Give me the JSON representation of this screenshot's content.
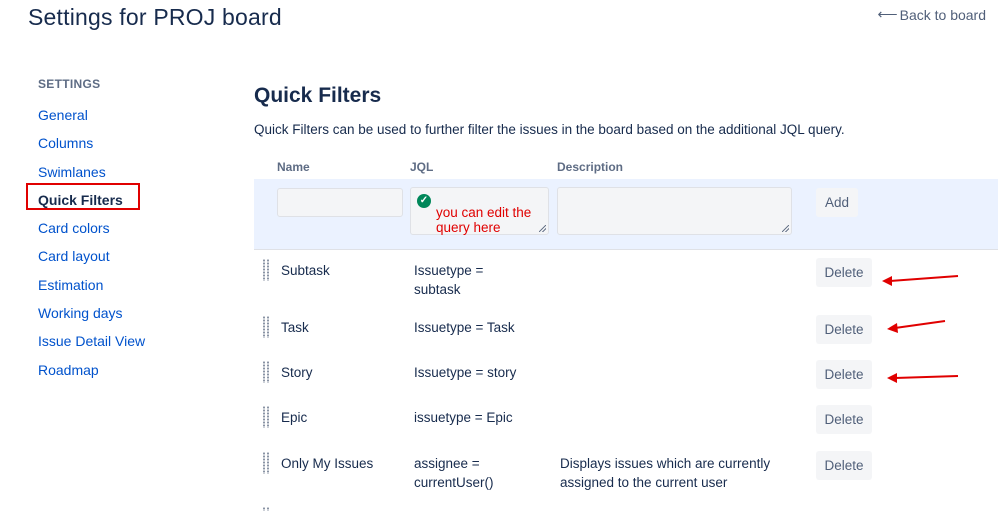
{
  "header": {
    "title": "Settings for PROJ board",
    "back_label": "Back to board",
    "back_icon": "arrow-left-icon"
  },
  "sidebar": {
    "heading": "SETTINGS",
    "items": [
      {
        "label": "General"
      },
      {
        "label": "Columns"
      },
      {
        "label": "Swimlanes"
      },
      {
        "label": "Quick Filters",
        "active": true
      },
      {
        "label": "Card colors"
      },
      {
        "label": "Card layout"
      },
      {
        "label": "Estimation"
      },
      {
        "label": "Working days"
      },
      {
        "label": "Issue Detail View"
      },
      {
        "label": "Roadmap"
      }
    ]
  },
  "main": {
    "title": "Quick Filters",
    "description": "Quick Filters can be used to further filter the issues in the board based on the additional JQL query.",
    "columns": {
      "name": "Name",
      "jql": "JQL",
      "description": "Description"
    },
    "add_form": {
      "name_value": "",
      "jql_annotation": "you can edit the query here",
      "description_value": "",
      "add_label": "Add"
    },
    "filters": [
      {
        "name": "Subtask",
        "jql_line1": "Issuetype =",
        "jql_line2": "subtask",
        "desc_line1": "",
        "desc_line2": "",
        "delete_label": "Delete",
        "annotated": true
      },
      {
        "name": "Task",
        "jql_line1": "Issuetype = Task",
        "jql_line2": "",
        "desc_line1": "",
        "desc_line2": "",
        "delete_label": "Delete",
        "annotated": true
      },
      {
        "name": "Story",
        "jql_line1": "Issuetype = story",
        "jql_line2": "",
        "desc_line1": "",
        "desc_line2": "",
        "delete_label": "Delete",
        "annotated": true
      },
      {
        "name": "Epic",
        "jql_line1": "issuetype = Epic",
        "jql_line2": "",
        "desc_line1": "",
        "desc_line2": "",
        "delete_label": "Delete",
        "annotated": false
      },
      {
        "name": "Only My Issues",
        "jql_line1": "assignee =",
        "jql_line2": "currentUser()",
        "desc_line1": "Displays issues which are currently",
        "desc_line2": "assigned to the current user",
        "delete_label": "Delete",
        "annotated": false
      }
    ]
  },
  "colors": {
    "annotation_red": "#e00000",
    "link_blue": "#0052cc",
    "add_row_bg": "#ebf2ff"
  }
}
